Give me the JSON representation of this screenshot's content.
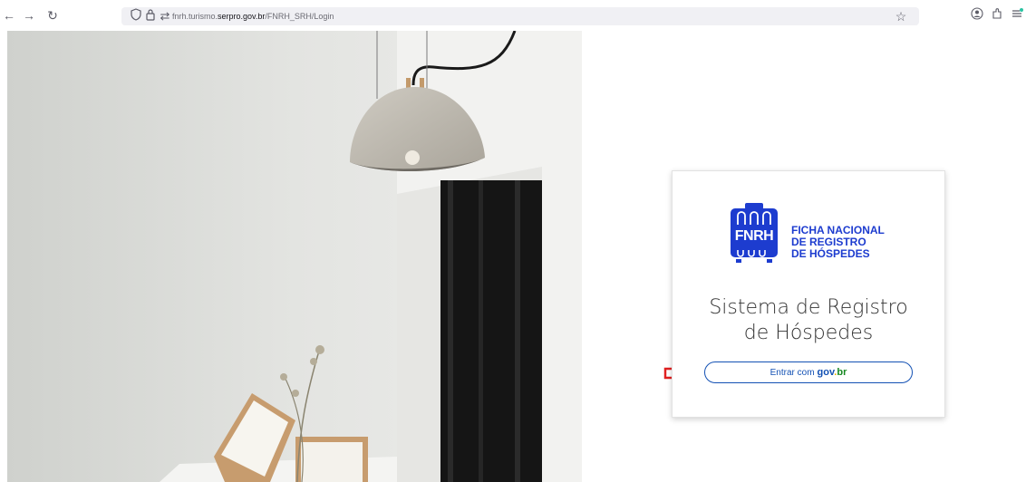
{
  "browser": {
    "url_prefix": "fnrh.turismo.",
    "url_domain": "serpro.gov.br",
    "url_path": "/FNRH_SRH/Login",
    "icons": {
      "back": "back-arrow-icon",
      "forward": "forward-arrow-icon",
      "reload": "reload-icon",
      "shield": "shield-icon",
      "lock": "lock-icon",
      "permissions": "permissions-icon",
      "bookmark": "star-icon",
      "account": "account-icon",
      "extensions": "extensions-icon",
      "menu": "menu-icon"
    }
  },
  "login_card": {
    "logo_short": "FNRH",
    "logo_lines": [
      "FICHA NACIONAL",
      "DE REGISTRO",
      "DE HÓSPEDES"
    ],
    "title_line1": "Sistema de Registro",
    "title_line2": "de Hóspedes",
    "login_button_label": "Entrar com",
    "govbr_logo": {
      "part1": "gov",
      "part2": ".",
      "part3": "br"
    }
  },
  "colors": {
    "brand_blue": "#1d3ccf",
    "govbr_blue": "#1351b4",
    "govbr_yellow": "#f5b500",
    "govbr_green": "#168821",
    "annotation_red": "#e02020"
  }
}
